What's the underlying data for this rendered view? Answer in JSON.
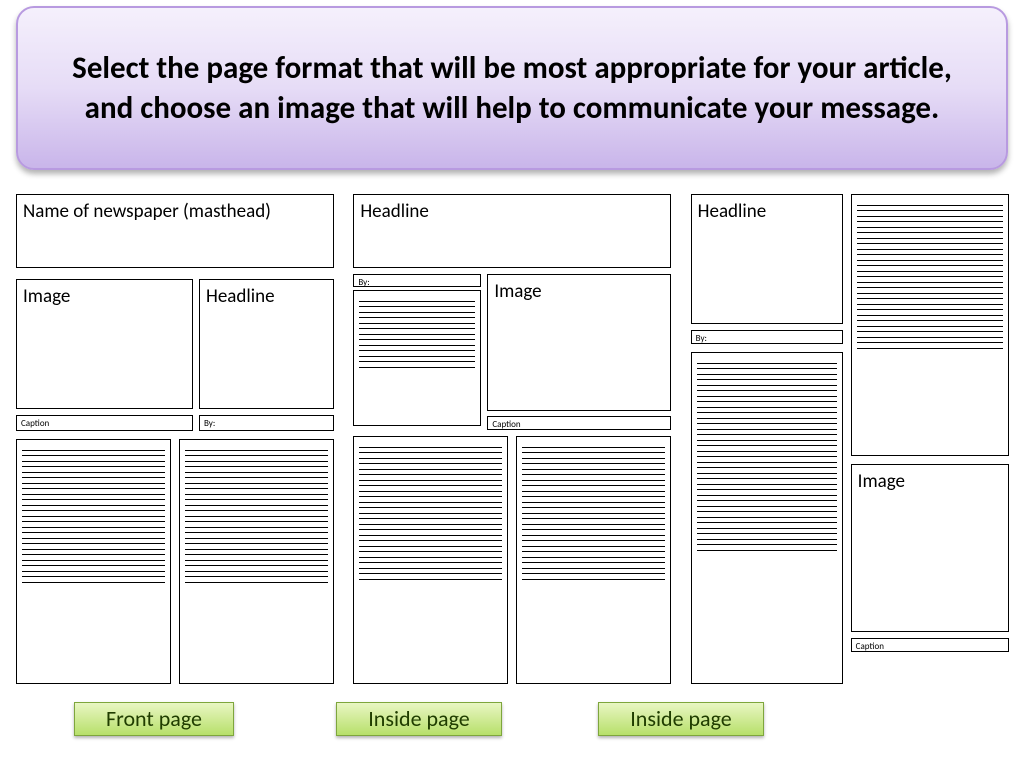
{
  "instruction": "Select the page format that will be most appropriate for your article, and choose an image that will help to communicate your message.",
  "labels": {
    "masthead": "Name of newspaper (masthead)",
    "headline": "Headline",
    "image": "Image",
    "caption": "Caption",
    "by": "By:"
  },
  "buttons": {
    "front": "Front page",
    "inside1": "Inside page",
    "inside2": "Inside page"
  }
}
